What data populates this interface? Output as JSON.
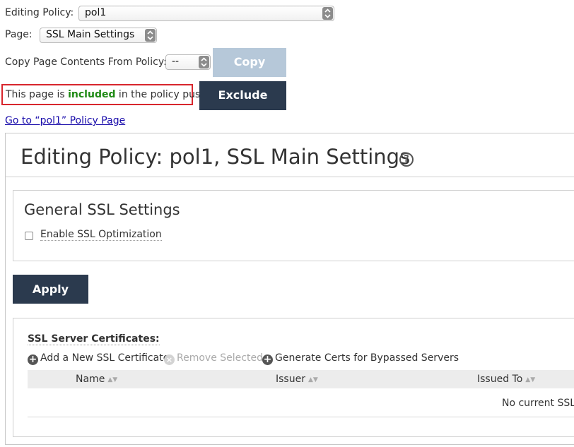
{
  "editing_policy": {
    "label": "Editing Policy:",
    "value": "pol1"
  },
  "page_select": {
    "label": "Page:",
    "value": "SSL Main Settings"
  },
  "copy_from": {
    "label": "Copy Page Contents From Policy:",
    "value": "--",
    "button": "Copy"
  },
  "inclusion": {
    "prefix": "This page is ",
    "status": "included",
    "suffix": " in the policy push.",
    "button": "Exclude"
  },
  "goto_link": "Go to “pol1” Policy Page",
  "main": {
    "title": "Editing Policy: pol1, SSL Main Settings",
    "help_glyph": "?",
    "general": {
      "title": "General SSL Settings",
      "enable_ssl_label": "Enable SSL Optimization",
      "enable_ssl_checked": false
    },
    "apply_button": "Apply",
    "certs": {
      "title": "SSL Server Certificates:",
      "actions": {
        "add": "Add a New SSL Certificate",
        "remove": "Remove Selected",
        "generate": "Generate Certs for Bypassed Servers"
      },
      "columns": [
        "Name",
        "Issuer",
        "Issued To"
      ],
      "empty_message": "No current SSL c"
    }
  },
  "colors": {
    "dark_button": "#2b3a4e",
    "disabled_button": "#b6c8d9",
    "included_green": "#1e8a14",
    "notice_border": "#d8262d",
    "link": "#1a0dab"
  }
}
